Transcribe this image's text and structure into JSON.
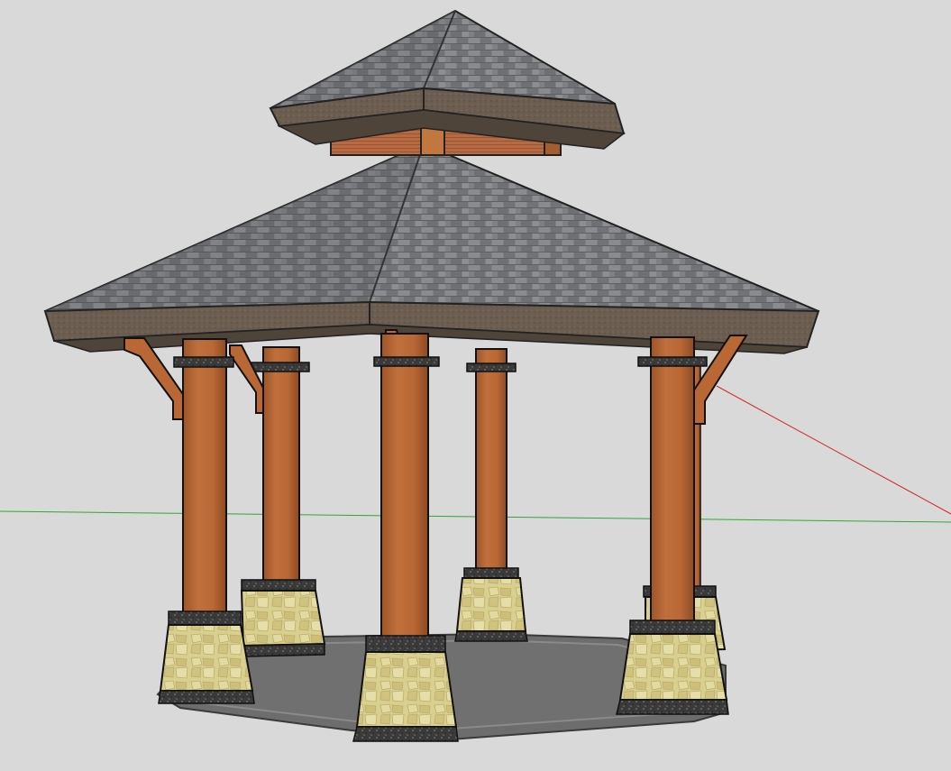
{
  "scene": {
    "subject": "gazebo-3d-model",
    "background_color": "#d9d9d9",
    "axes": {
      "green_axis_color": "#2fa82f",
      "red_axis_color": "#d22a2a"
    },
    "colors": {
      "roof_shingle": "#7f8083",
      "roof_shingle_dark": "#5d5f63",
      "roof_fascia": "#6b5d4f",
      "roof_fascia_dark": "#4f4439",
      "cupola_wood": "#b4683a",
      "post_wood": "#b86735",
      "post_wood_dark": "#8c4a23",
      "stone_base": "#d9cf8f",
      "stone_base_dark": "#b9ad6e",
      "cap_granite": "#3a3a3a",
      "floor": "#6d6d6d",
      "floor_edge": "#8a8a8a"
    }
  }
}
